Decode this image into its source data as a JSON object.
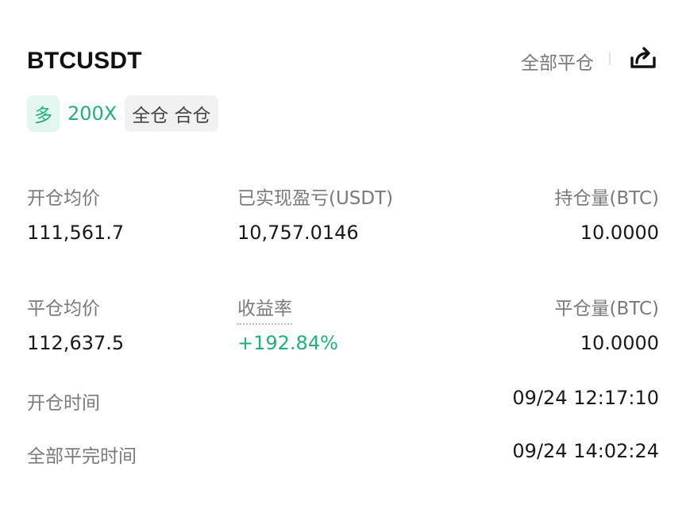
{
  "header": {
    "symbol": "BTCUSDT",
    "close_all_label": "全部平仓",
    "share_icon": "share-icon"
  },
  "tags": {
    "side": "多",
    "leverage": "200X",
    "margin_mode": "全仓 合仓"
  },
  "stats": {
    "open_avg_label": "开仓均价",
    "open_avg_value": "111,561.7",
    "realized_pnl_label": "已实现盈亏(USDT)",
    "realized_pnl_value": "10,757.0146",
    "position_size_label": "持仓量(BTC)",
    "position_size_value": "10.0000",
    "close_avg_label": "平仓均价",
    "close_avg_value": "112,637.5",
    "roi_label": "收益率",
    "roi_value": "+192.84%",
    "closed_size_label": "平仓量(BTC)",
    "closed_size_value": "10.0000"
  },
  "times": {
    "open_time_label": "开仓时间",
    "open_time_value": "09/24 12:17:10",
    "full_close_time_label": "全部平完时间",
    "full_close_time_value": "09/24 14:02:24"
  },
  "colors": {
    "accent_green": "#1fb07c",
    "tag_green_bg": "#e3f6ef",
    "label_gray": "#7a7a7a",
    "text_dark": "#111111"
  }
}
